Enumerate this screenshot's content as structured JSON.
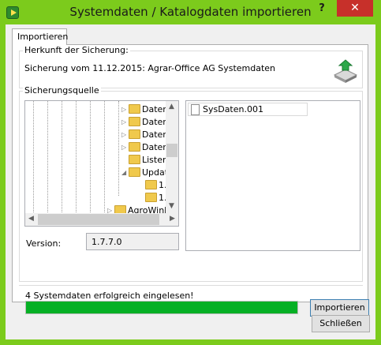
{
  "window": {
    "title": "Systemdaten / Katalogdaten importieren",
    "help_label": "?",
    "close_label": "✕"
  },
  "tab": {
    "label": "Importieren"
  },
  "herkunft": {
    "title": "Herkunft der Sicherung:",
    "text": "Sicherung vom 11.12.2015: Agrar-Office AG Systemdaten"
  },
  "quelle": {
    "title": "Sicherungsquelle",
    "tree": [
      "Daten",
      "Daten",
      "Daten",
      "Daten",
      "Listen",
      "Updat",
      "1.",
      "1.",
      "AgroWinD"
    ],
    "files": [
      "SysDaten.001"
    ],
    "version_label": "Version:",
    "version_value": "1.7.7.0"
  },
  "status": {
    "text": "4 Systemdaten erfolgreich eingelesen!",
    "progress": 1.0,
    "progress_color": "#06b025"
  },
  "buttons": {
    "import": "Importieren",
    "close": "Schließen"
  },
  "colors": {
    "frame": "#7ccb1c",
    "close_button": "#c7302a"
  }
}
